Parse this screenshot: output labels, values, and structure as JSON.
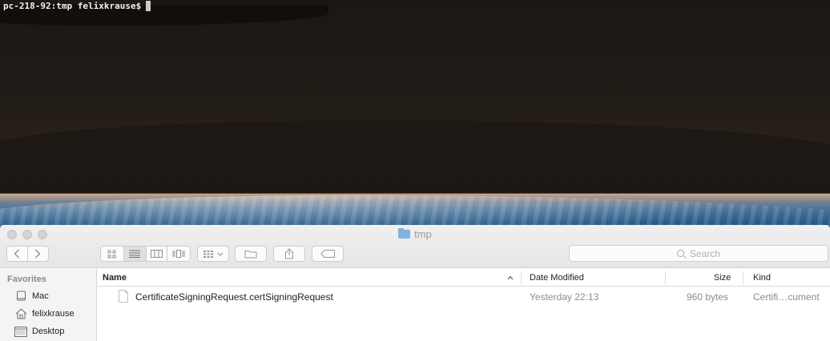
{
  "terminal": {
    "prompt": "pc-218-92:tmp felixkrause$"
  },
  "finder": {
    "title": "tmp",
    "title_icon": "folder-icon",
    "search": {
      "placeholder": "Search"
    },
    "toolbar": {
      "back_icon": "chevron-left-icon",
      "forward_icon": "chevron-right-icon",
      "view_icons": [
        "icon-view-icon",
        "list-view-icon",
        "column-view-icon",
        "cover-flow-icon"
      ],
      "arrange_icon": "arrange-icon",
      "action_icons": [
        "new-folder-icon",
        "share-icon",
        "tag-icon"
      ]
    },
    "sidebar": {
      "header": "Favorites",
      "items": [
        {
          "label": "Mac",
          "icon": "computer-icon"
        },
        {
          "label": "felixkrause",
          "icon": "home-icon"
        },
        {
          "label": "Desktop",
          "icon": "desktop-icon"
        }
      ]
    },
    "columns": {
      "name": "Name",
      "date": "Date Modified",
      "size": "Size",
      "kind": "Kind"
    },
    "files": [
      {
        "name": "CertificateSigningRequest.certSigningRequest",
        "date": "Yesterday 22:13",
        "size": "960 bytes",
        "kind": "Certifi…cument"
      }
    ]
  }
}
